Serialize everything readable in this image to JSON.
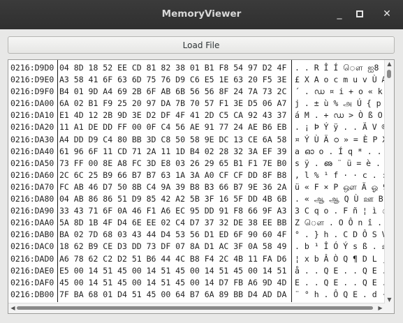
{
  "window": {
    "title": "MemoryViewer",
    "minimize": "_",
    "maximize": "▢",
    "close": "✕"
  },
  "toolbar": {
    "load_label": "Load File"
  },
  "rows": [
    {
      "addr": "0216:D9D0",
      "hex": "04 8D 18 52 EE CD 81 82 38 01 B1 F8 54 97 D2 4F",
      "ascii": ". . R Î Í ௌ ஐ8 . ±"
    },
    {
      "addr": "0216:D9E0",
      "hex": "A3 58 41 6F 63 6D 75 76 D9 C6 E5 1E 63 20 F5 3E",
      "ascii": "£ X A o c m u v Ù Æ"
    },
    {
      "addr": "0216:D9F0",
      "hex": "B4 01 9D A4 69 2B 6F AB 6B 56 56 8F 24 7A 73 2C",
      "ascii": "´ . ഡ ¤ i + o « k V"
    },
    {
      "addr": "0216:DA00",
      "hex": "6A 02 B1 F9 25 20 97 DA 7B 70 57 F1 3E D5 06 A7",
      "ascii": "j . ± ù % அ Ú { p"
    },
    {
      "addr": "0216:DA10",
      "hex": "E1 4D 12 2B 9D 3E D2 DF 4F 41 2D C5 CA 92 43 37",
      "ascii": "á M . + ഡ > Ò ß O A"
    },
    {
      "addr": "0216:DA20",
      "hex": "11 A1 DE DD FF 00 0F C4 56 AE 91 77 24 AE B6 EB",
      "ascii": ". ¡ Þ Ý ÿ . . Ä V ®"
    },
    {
      "addr": "0216:DA30",
      "hex": "A4 DD D9 C4 80 BB 3D C8 50 58 9E DC 13 CE 6A 58",
      "ascii": "¤ Ý Ù Ä ഠ » = È P X"
    },
    {
      "addr": "0216:DA40",
      "hex": "61 96 6F 11 CD 71 2A 11 1D B4 02 28 32 3A EF 39",
      "ascii": "a ഓ o . Í q * . . ´"
    },
    {
      "addr": "0216:DA50",
      "hex": "73 FF 00 8E A8 FC 3D E8 03 26 29 65 B1 F1 7E B0",
      "ascii": "s ÿ . ഌ ¨ ü = è . &"
    },
    {
      "addr": "0216:DA60",
      "hex": "2C 6C 25 B9 66 B7 B7 63 1A 3A A0 CF CF DD 8F B8",
      "ascii": ", l % ¹ f · · c . :"
    },
    {
      "addr": "0216:DA70",
      "hex": "FC AB 46 D7 50 8B C4 9A 39 B8 B3 66 B7 9E 36 2A",
      "ascii": "ü « F × P ஔ Ä ஓ 9 ¸"
    },
    {
      "addr": "0216:DA80",
      "hex": "04 AB 86 86 51 D9 85 42 A2 5B 3F 16 5F DD 4B 6B",
      "ascii": ". « ஆ ஆ Q Ù ஊ B ¢ ["
    },
    {
      "addr": "0216:DA90",
      "hex": "33 43 71 6F 0A 46 F1 A6 EC 95 DD 91 F8 66 9F A3",
      "ascii": "3 C q o . F ñ ¦ ì ௗ"
    },
    {
      "addr": "0216:DAA0",
      "hex": "5A 8D 1B 4F D4 6E EE 02 C4 D7 37 32 DE 38 EE BB",
      "ascii": "Z ௌ . O Ô n î . Ä ×"
    },
    {
      "addr": "0216:DAB0",
      "hex": "BA 02 7D 68 03 43 44 D4 53 56 D1 ED 6F 90 60 4F",
      "ascii": "° . } h . C D Ô S V"
    },
    {
      "addr": "0216:DAC0",
      "hex": "18 62 B9 CE D3 DD 73 DF 07 8A D1 AC 3F 0A 58 49",
      "ascii": ". b ¹ Î Ó Ý s ß . ஊ"
    },
    {
      "addr": "0216:DAD0",
      "hex": "A6 78 62 C2 D2 51 B6 44 4C B8 F4 2C 4B 11 FA D6",
      "ascii": "¦ x b Â Ò Q ¶ D L ¸"
    },
    {
      "addr": "0216:DAE0",
      "hex": "E5 00 14 51 45 00 14 51 45 00 14 51 45 00 14 51",
      "ascii": "å . . Q E . . Q E ."
    },
    {
      "addr": "0216:DAF0",
      "hex": "45 00 14 51 45 00 14 51 45 00 14 D7 FB A6 9D 4D",
      "ascii": "E . . Q E . . Q E ."
    },
    {
      "addr": "0216:DB00",
      "hex": "7F BA 68 01 D4 51 45 00 64 B7 6A 89 BB D4 AD DA",
      "ascii": "¨ ° h . Ô Q E . d ·"
    },
    {
      "addr": "0216:DB10",
      "hex": "",
      "ascii": ""
    }
  ]
}
